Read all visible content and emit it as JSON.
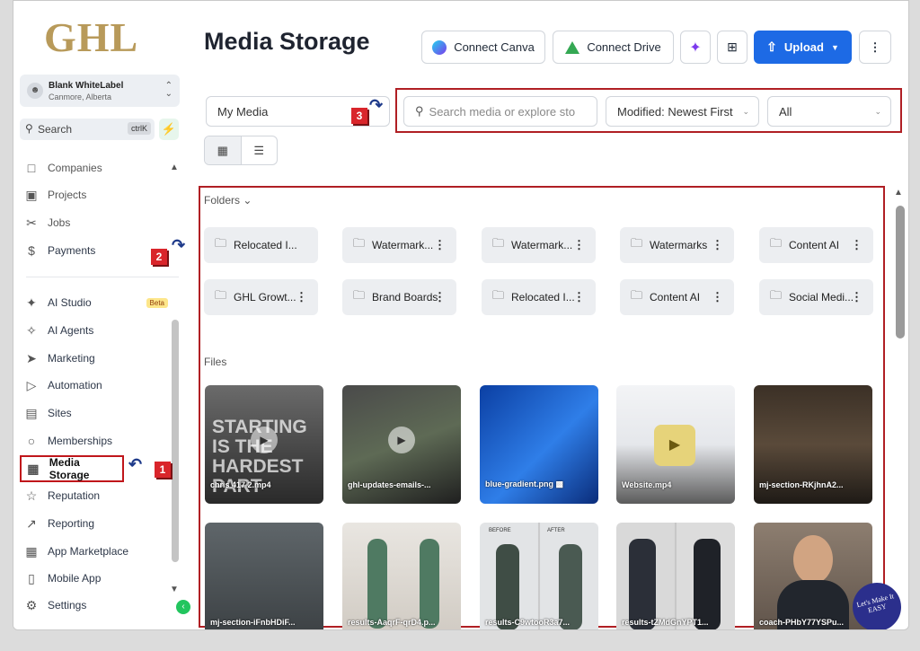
{
  "brand": {
    "logo_text": "GHL"
  },
  "account": {
    "name": "Blank WhiteLabel",
    "location": "Canmore, Alberta"
  },
  "sidebar": {
    "search_label": "Search",
    "search_shortcut": "ctrlK",
    "items": [
      {
        "label": "Companies",
        "icon": "building-icon"
      },
      {
        "label": "Projects",
        "icon": "briefcase-icon"
      },
      {
        "label": "Jobs",
        "icon": "scissors-icon"
      },
      {
        "label": "Payments",
        "icon": "dollar-icon"
      },
      {
        "label": "AI Studio",
        "icon": "ai-studio-icon",
        "badge": "Beta"
      },
      {
        "label": "AI Agents",
        "icon": "sparkle-icon"
      },
      {
        "label": "Marketing",
        "icon": "send-icon"
      },
      {
        "label": "Automation",
        "icon": "play-circle-icon"
      },
      {
        "label": "Sites",
        "icon": "browser-icon"
      },
      {
        "label": "Memberships",
        "icon": "award-icon"
      },
      {
        "label": "Media Storage",
        "icon": "image-icon"
      },
      {
        "label": "Reputation",
        "icon": "star-icon"
      },
      {
        "label": "Reporting",
        "icon": "trend-icon"
      },
      {
        "label": "App Marketplace",
        "icon": "grid-icon"
      },
      {
        "label": "Mobile App",
        "icon": "phone-icon"
      },
      {
        "label": "Settings",
        "icon": "gear-icon"
      }
    ]
  },
  "header": {
    "title": "Media Storage",
    "connect_canva": "Connect Canva",
    "connect_drive": "Connect Drive",
    "upload": "Upload"
  },
  "filters": {
    "scope": "My Media",
    "search_placeholder": "Search media or explore sto",
    "sort": "Modified: Newest First",
    "type": "All"
  },
  "folders_label": "Folders",
  "folders": [
    "Relocated I...",
    "Watermark...",
    "Watermark...",
    "Watermarks",
    "Content AI",
    "GHL Growt...",
    "Brand Boards",
    "Relocated I...",
    "Content AI",
    "Social Medi..."
  ],
  "files_label": "Files",
  "files": [
    {
      "name": "chris 417 2.mp4",
      "overlay_text": "STARTING IS THE HARDEST PART"
    },
    {
      "name": "ghl-updates-emails-..."
    },
    {
      "name": "blue-gradient.png"
    },
    {
      "name": "Website.mp4"
    },
    {
      "name": "mj-section-RKjhnA2..."
    },
    {
      "name": "mj-section-iFnbHDiF..."
    },
    {
      "name": "results-AaqrF-qrD4.p..."
    },
    {
      "name": "results-C9wtooR3a7...",
      "before_label": "BEFORE",
      "after_label": "AFTER"
    },
    {
      "name": "results-tZMdGnYPT1..."
    },
    {
      "name": "coach-PHbY77YSPu..."
    }
  ],
  "markers": [
    "1",
    "2",
    "3"
  ],
  "watermark": "Let's Make It EASY",
  "colors": {
    "accent": "#1d6ae5",
    "annotation": "#b01f24",
    "logo": "#b89a5a"
  }
}
